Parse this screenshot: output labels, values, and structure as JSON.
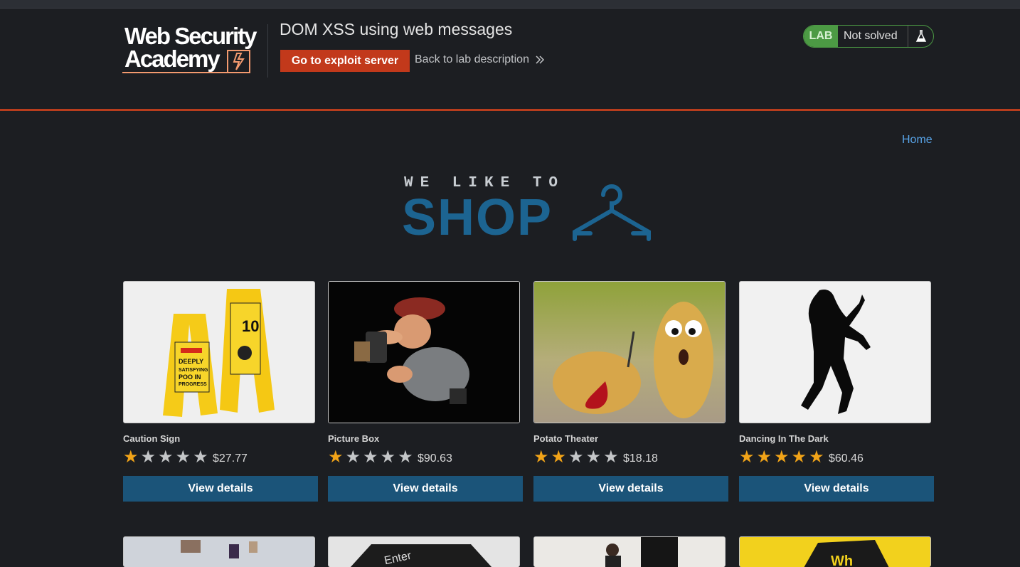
{
  "logo": {
    "line1": "Web Security",
    "line2": "Academy"
  },
  "lab": {
    "title": "DOM XSS using web messages",
    "exploit_button": "Go to exploit server",
    "back_link": "Back to lab description",
    "status_tag": "LAB",
    "status_text": "Not solved"
  },
  "nav": {
    "home": "Home"
  },
  "banner": {
    "small": "WE LIKE TO",
    "big": "SHOP"
  },
  "colors": {
    "accent": "#c2391b",
    "button": "#1b5479",
    "star_on": "#f2a418",
    "star_off": "#c4c6c8",
    "status_green": "#4c9a44"
  },
  "products": [
    {
      "name": "Caution Sign",
      "rating": 1,
      "price": "$27.77",
      "button": "View details"
    },
    {
      "name": "Picture Box",
      "rating": 1,
      "price": "$90.63",
      "button": "View details"
    },
    {
      "name": "Potato Theater",
      "rating": 2,
      "price": "$18.18",
      "button": "View details"
    },
    {
      "name": "Dancing In The Dark",
      "rating": 5,
      "price": "$60.46",
      "button": "View details"
    }
  ]
}
